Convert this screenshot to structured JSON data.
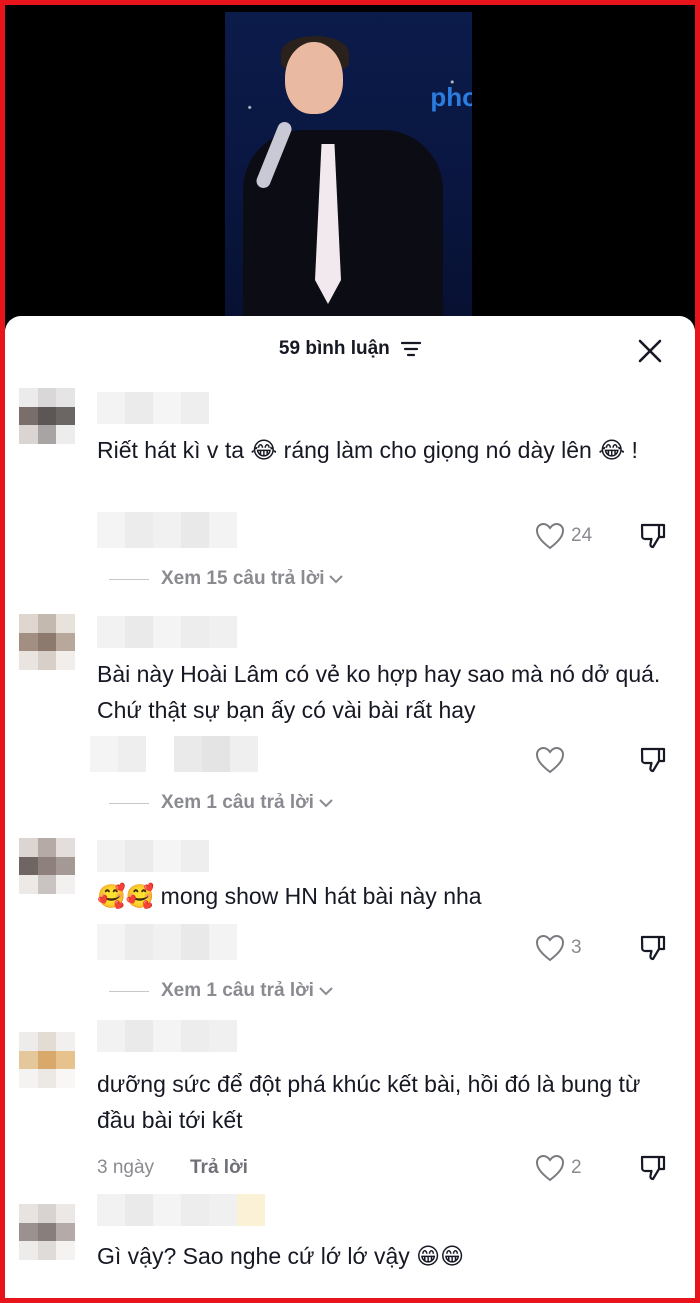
{
  "header": {
    "comment_count_label": "59 bình luận"
  },
  "comments": [
    {
      "text": "Riết hát kì v ta 😂 ráng làm cho giọng nó dày lên 😂 !",
      "likes": "24",
      "view_replies": "Xem 15 câu trả lời"
    },
    {
      "text": "Bài này Hoài Lâm có vẻ ko hợp hay sao mà nó dở quá. Chứ thật sự bạn ấy có vài bài rất hay",
      "likes": "",
      "view_replies": "Xem 1 câu trả lời"
    },
    {
      "text": "🥰🥰 mong show HN hát bài này nha",
      "likes": "3",
      "view_replies": "Xem 1 câu trả lời"
    },
    {
      "text": "dưỡng sức để đột phá khúc kết bài, hồi đó là bung từ đầu bài tới kết",
      "time": "3 ngày",
      "reply": "Trả lời",
      "likes": "2"
    },
    {
      "text": "Gì vậy? Sao nghe cứ lớ lớ vậy 😁😁"
    }
  ],
  "colors": {
    "frame": "#e8141c",
    "text": "#161823",
    "muted": "#8a8b91"
  },
  "icons": [
    "filter-icon",
    "close-icon",
    "heart-icon",
    "dislike-icon",
    "chevron-down-icon"
  ]
}
